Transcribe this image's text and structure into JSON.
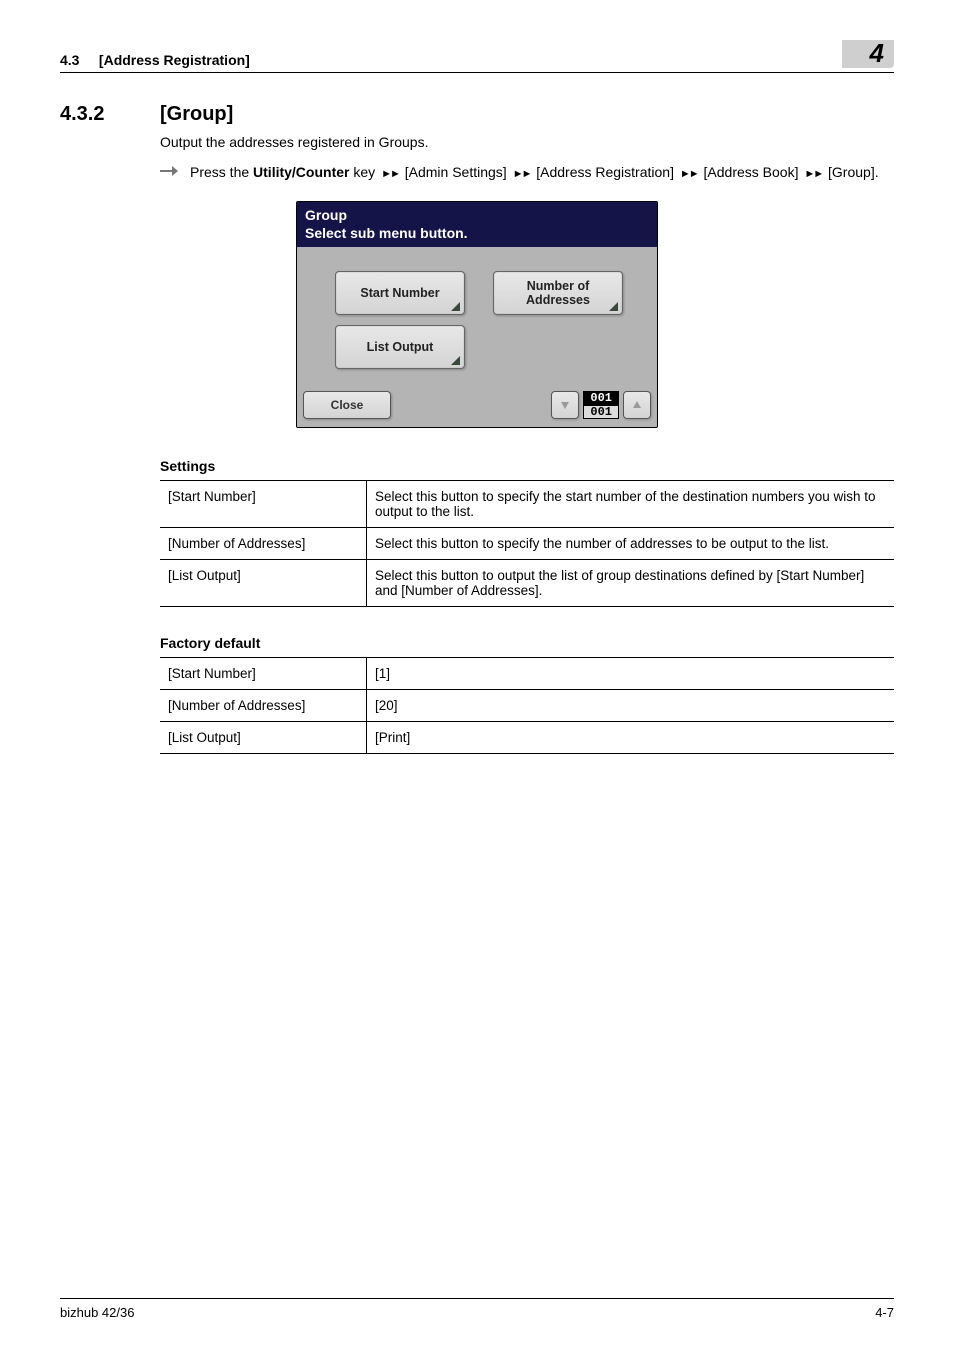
{
  "header": {
    "section_num": "4.3",
    "section_title": "[Address Registration]",
    "chapter_tab": "4"
  },
  "section": {
    "number": "4.3.2",
    "title": "[Group]",
    "intro": "Output the addresses registered in Groups."
  },
  "step": {
    "prefix": "Press the ",
    "bold": "Utility/Counter",
    "after_bold": " key ",
    "crumbs": [
      "[Admin Settings]",
      "[Address Registration]",
      "[Address Book]",
      "[Group]."
    ]
  },
  "panel": {
    "title": "Group",
    "subtitle": "Select sub menu button.",
    "buttons": {
      "start_number": "Start Number",
      "num_addresses_line1": "Number of",
      "num_addresses_line2": "Addresses",
      "list_output": "List Output",
      "close": "Close"
    },
    "pager": {
      "current": "001",
      "total": "001"
    }
  },
  "tables": {
    "settings_title": "Settings",
    "settings_rows": [
      {
        "name": "[Start Number]",
        "desc": "Select this button to specify the start number of the destination numbers you wish to output to the list."
      },
      {
        "name": "[Number of Addresses]",
        "desc": "Select this button to specify the number of addresses to be output to the list."
      },
      {
        "name": "[List Output]",
        "desc": "Select this button to output the list of group destinations defined by [Start Number] and [Number of Addresses]."
      }
    ],
    "defaults_title": "Factory default",
    "defaults_rows": [
      {
        "name": "[Start Number]",
        "value": "[1]"
      },
      {
        "name": "[Number of Addresses]",
        "value": "[20]"
      },
      {
        "name": "[List Output]",
        "value": "[Print]"
      }
    ]
  },
  "footer": {
    "product": "bizhub 42/36",
    "page": "4-7"
  }
}
